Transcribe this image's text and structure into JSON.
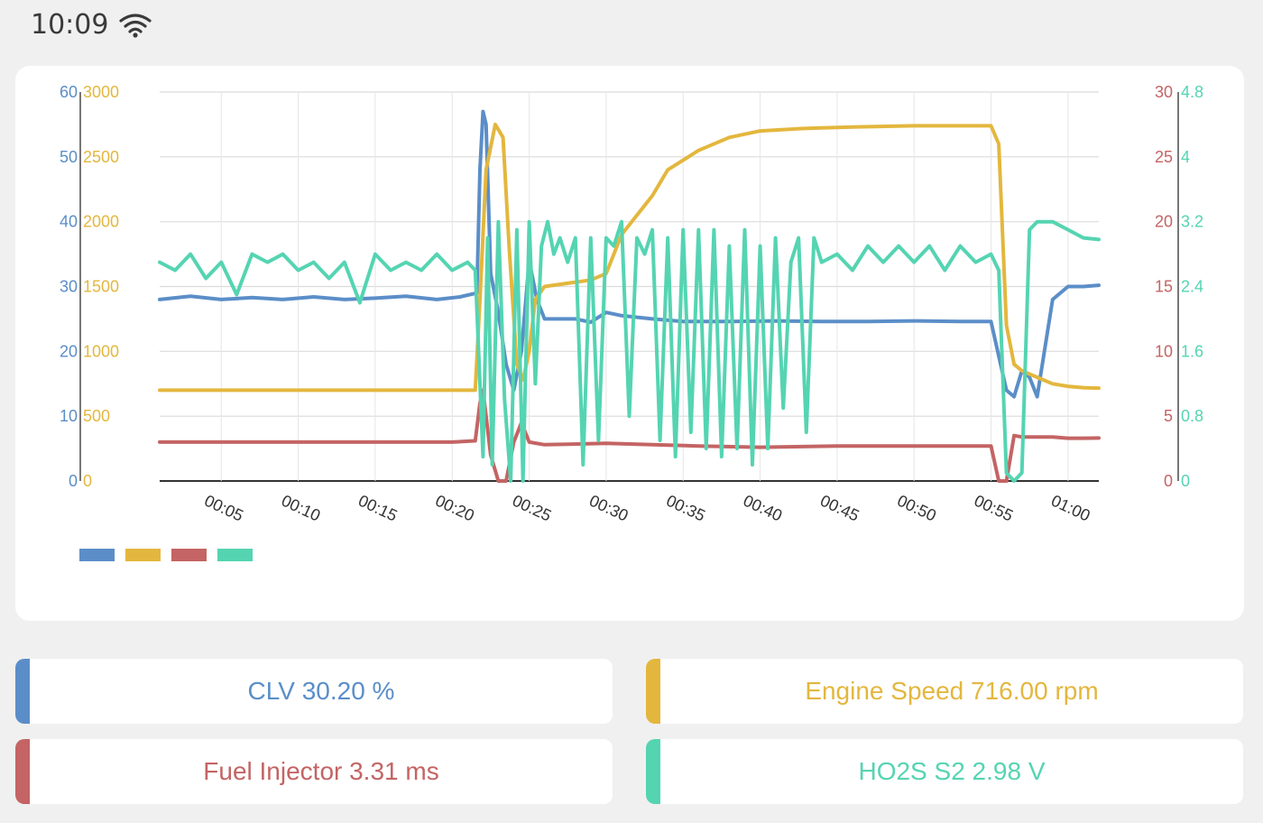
{
  "status_bar": {
    "time": "10:09",
    "wifi_icon": "wifi-icon"
  },
  "colors": {
    "clv": "#5b8ec8",
    "rpm": "#e3b73e",
    "inj": "#c46464",
    "ho2s": "#55d4b2"
  },
  "readouts": [
    {
      "text": "CLV 30.20 %",
      "color": "#5b8ec8"
    },
    {
      "text": "Engine Speed 716.00 rpm",
      "color": "#e3b73e"
    },
    {
      "text": "Fuel Injector 3.31 ms",
      "color": "#c46464"
    },
    {
      "text": "HO2S S2 2.98 V",
      "color": "#55d4b2"
    }
  ],
  "chart_data": {
    "type": "line",
    "grid": true,
    "legend": "bottom-left",
    "x_ticks": [
      "00:05",
      "00:10",
      "00:15",
      "00:20",
      "00:25",
      "00:30",
      "00:35",
      "00:40",
      "00:45",
      "00:50",
      "00:55",
      "01:00"
    ],
    "axes": {
      "left_outer": {
        "ticks": [
          "60",
          "50",
          "40",
          "30",
          "20",
          "10",
          "0"
        ],
        "color": "#5b8ec8",
        "range": [
          0,
          60
        ]
      },
      "left_inner": {
        "ticks": [
          "3000",
          "2500",
          "2000",
          "1500",
          "1000",
          "500",
          "0"
        ],
        "color": "#e3b73e",
        "range": [
          0,
          3000
        ]
      },
      "right_inner": {
        "ticks": [
          "30",
          "25",
          "20",
          "15",
          "10",
          "5",
          "0"
        ],
        "color": "#c46464",
        "range": [
          0,
          30
        ]
      },
      "right_outer": {
        "ticks": [
          "4.8",
          "4",
          "3.2",
          "2.4",
          "1.6",
          "0.8",
          "0"
        ],
        "color": "#55d4b2",
        "range": [
          0,
          4.8
        ]
      }
    },
    "series": [
      {
        "color": "#5b8ec8",
        "axis": "left_outer",
        "points": [
          [
            1,
            28
          ],
          [
            3,
            28.5
          ],
          [
            5,
            28
          ],
          [
            7,
            28.3
          ],
          [
            9,
            28
          ],
          [
            11,
            28.4
          ],
          [
            13,
            28
          ],
          [
            15,
            28.2
          ],
          [
            17,
            28.5
          ],
          [
            19,
            28
          ],
          [
            20.5,
            28.4
          ],
          [
            21.6,
            29
          ],
          [
            21.8,
            48
          ],
          [
            22,
            57
          ],
          [
            22.2,
            55
          ],
          [
            22.5,
            32
          ],
          [
            23,
            26
          ],
          [
            23.5,
            18
          ],
          [
            24,
            14
          ],
          [
            24.5,
            20
          ],
          [
            25,
            34
          ],
          [
            25.5,
            28
          ],
          [
            26,
            25
          ],
          [
            28,
            25
          ],
          [
            29,
            24.5
          ],
          [
            30,
            26
          ],
          [
            31,
            25.5
          ],
          [
            33,
            25
          ],
          [
            35,
            24.6
          ],
          [
            38,
            24.6
          ],
          [
            41,
            24.7
          ],
          [
            44,
            24.6
          ],
          [
            47,
            24.6
          ],
          [
            50,
            24.7
          ],
          [
            53,
            24.6
          ],
          [
            55,
            24.6
          ],
          [
            56,
            14
          ],
          [
            56.5,
            13
          ],
          [
            57,
            17
          ],
          [
            57.5,
            16
          ],
          [
            58,
            13
          ],
          [
            59,
            28
          ],
          [
            60,
            30
          ],
          [
            61,
            30
          ],
          [
            62,
            30.2
          ]
        ]
      },
      {
        "color": "#e3b73e",
        "axis": "left_inner",
        "points": [
          [
            1,
            700
          ],
          [
            5,
            700
          ],
          [
            10,
            700
          ],
          [
            15,
            700
          ],
          [
            20,
            700
          ],
          [
            21.5,
            700
          ],
          [
            21.8,
            1400
          ],
          [
            22.2,
            2400
          ],
          [
            22.8,
            2750
          ],
          [
            23.3,
            2650
          ],
          [
            23.7,
            1800
          ],
          [
            24.2,
            900
          ],
          [
            24.6,
            780
          ],
          [
            25,
            1000
          ],
          [
            25.4,
            1400
          ],
          [
            26,
            1500
          ],
          [
            29,
            1550
          ],
          [
            30,
            1600
          ],
          [
            31,
            1900
          ],
          [
            33,
            2200
          ],
          [
            34,
            2400
          ],
          [
            36,
            2550
          ],
          [
            38,
            2650
          ],
          [
            40,
            2700
          ],
          [
            43,
            2720
          ],
          [
            46,
            2730
          ],
          [
            50,
            2740
          ],
          [
            54,
            2740
          ],
          [
            55,
            2740
          ],
          [
            55.5,
            2600
          ],
          [
            56,
            1200
          ],
          [
            56.5,
            900
          ],
          [
            57,
            850
          ],
          [
            58,
            800
          ],
          [
            59,
            750
          ],
          [
            60,
            730
          ],
          [
            61,
            720
          ],
          [
            62,
            716
          ]
        ]
      },
      {
        "color": "#c46464",
        "axis": "right_inner",
        "points": [
          [
            1,
            3
          ],
          [
            5,
            3
          ],
          [
            10,
            3
          ],
          [
            15,
            3
          ],
          [
            20,
            3
          ],
          [
            21.5,
            3.1
          ],
          [
            21.8,
            6
          ],
          [
            22,
            7
          ],
          [
            22.5,
            2
          ],
          [
            23,
            0
          ],
          [
            23.5,
            0
          ],
          [
            24,
            3
          ],
          [
            24.5,
            4.5
          ],
          [
            25,
            3
          ],
          [
            26,
            2.8
          ],
          [
            30,
            2.9
          ],
          [
            33,
            2.8
          ],
          [
            36,
            2.7
          ],
          [
            40,
            2.6
          ],
          [
            45,
            2.7
          ],
          [
            50,
            2.7
          ],
          [
            55,
            2.7
          ],
          [
            55.5,
            0
          ],
          [
            56,
            0
          ],
          [
            56.5,
            3.5
          ],
          [
            57,
            3.4
          ],
          [
            58,
            3.4
          ],
          [
            59,
            3.4
          ],
          [
            60,
            3.3
          ],
          [
            61,
            3.3
          ],
          [
            62,
            3.31
          ]
        ]
      },
      {
        "color": "#55d4b2",
        "axis": "right_outer",
        "points": [
          [
            1,
            2.7
          ],
          [
            2,
            2.6
          ],
          [
            3,
            2.8
          ],
          [
            4,
            2.5
          ],
          [
            5,
            2.7
          ],
          [
            6,
            2.3
          ],
          [
            7,
            2.8
          ],
          [
            8,
            2.7
          ],
          [
            9,
            2.8
          ],
          [
            10,
            2.6
          ],
          [
            11,
            2.7
          ],
          [
            12,
            2.5
          ],
          [
            13,
            2.7
          ],
          [
            14,
            2.2
          ],
          [
            15,
            2.8
          ],
          [
            16,
            2.6
          ],
          [
            17,
            2.7
          ],
          [
            18,
            2.6
          ],
          [
            19,
            2.8
          ],
          [
            20,
            2.6
          ],
          [
            21,
            2.7
          ],
          [
            21.5,
            2.6
          ],
          [
            22,
            0.3
          ],
          [
            22.3,
            3.0
          ],
          [
            22.6,
            0.2
          ],
          [
            23,
            3.2
          ],
          [
            23.4,
            1.0
          ],
          [
            23.8,
            0.0
          ],
          [
            24.2,
            3.1
          ],
          [
            24.6,
            0.0
          ],
          [
            25,
            3.2
          ],
          [
            25.4,
            1.2
          ],
          [
            25.8,
            2.9
          ],
          [
            26.2,
            3.2
          ],
          [
            26.6,
            2.8
          ],
          [
            27,
            3.0
          ],
          [
            27.5,
            2.7
          ],
          [
            28,
            3.0
          ],
          [
            28.5,
            0.2
          ],
          [
            29,
            3.0
          ],
          [
            29.5,
            0.5
          ],
          [
            30,
            3.0
          ],
          [
            30.5,
            2.9
          ],
          [
            31,
            3.2
          ],
          [
            31.5,
            0.8
          ],
          [
            32,
            3.0
          ],
          [
            32.5,
            2.8
          ],
          [
            33,
            3.1
          ],
          [
            33.5,
            0.5
          ],
          [
            34,
            3.0
          ],
          [
            34.5,
            0.3
          ],
          [
            35,
            3.1
          ],
          [
            35.5,
            0.6
          ],
          [
            36,
            3.1
          ],
          [
            36.5,
            0.4
          ],
          [
            37,
            3.1
          ],
          [
            37.5,
            0.3
          ],
          [
            38,
            2.9
          ],
          [
            38.5,
            0.4
          ],
          [
            39,
            3.1
          ],
          [
            39.5,
            0.2
          ],
          [
            40,
            2.9
          ],
          [
            40.5,
            0.4
          ],
          [
            41,
            3.0
          ],
          [
            41.5,
            0.9
          ],
          [
            42,
            2.7
          ],
          [
            42.5,
            3.0
          ],
          [
            43,
            0.6
          ],
          [
            43.5,
            3.0
          ],
          [
            44,
            2.7
          ],
          [
            45,
            2.8
          ],
          [
            46,
            2.6
          ],
          [
            47,
            2.9
          ],
          [
            48,
            2.7
          ],
          [
            49,
            2.9
          ],
          [
            50,
            2.7
          ],
          [
            51,
            2.9
          ],
          [
            52,
            2.6
          ],
          [
            53,
            2.9
          ],
          [
            54,
            2.7
          ],
          [
            55,
            2.8
          ],
          [
            55.5,
            2.6
          ],
          [
            56,
            0.1
          ],
          [
            56.5,
            0.0
          ],
          [
            57,
            0.1
          ],
          [
            57.5,
            3.1
          ],
          [
            58,
            3.2
          ],
          [
            59,
            3.2
          ],
          [
            60,
            3.1
          ],
          [
            61,
            3.0
          ],
          [
            62,
            2.98
          ]
        ]
      }
    ]
  }
}
